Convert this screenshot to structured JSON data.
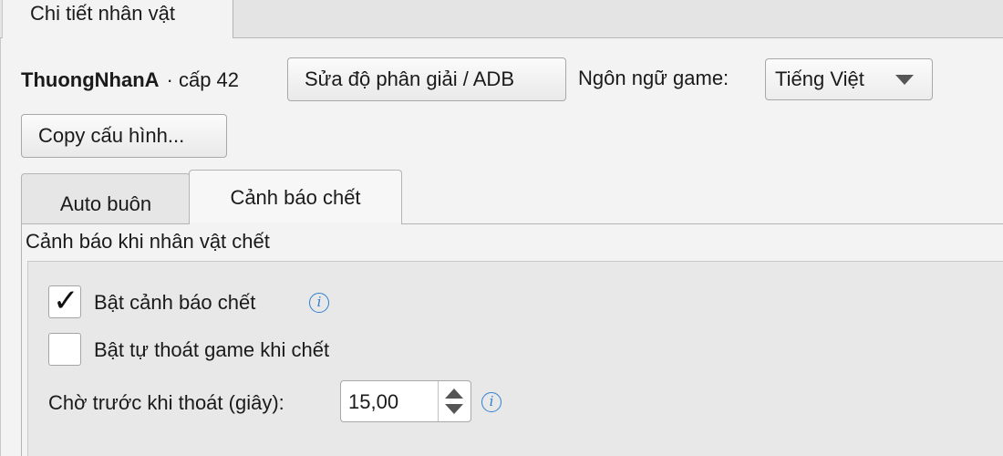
{
  "window": {
    "tab_label": "Chi tiết nhân vật"
  },
  "character": {
    "name": "ThuongNhanA",
    "level_text": "· cấp 42"
  },
  "toolbar": {
    "adb_button_label": "Sửa độ phân giải / ADB",
    "language_label": "Ngôn ngữ game:",
    "language_selected": "Tiếng Việt",
    "copy_config_label": "Copy cấu hình..."
  },
  "tabs": [
    {
      "label": "Auto buôn",
      "active": false
    },
    {
      "label": "Cảnh báo chết",
      "active": true
    }
  ],
  "death_alert": {
    "group_title": "Cảnh báo khi nhân vật chết",
    "enable_alert": {
      "label": "Bật cảnh báo chết",
      "checked": true,
      "checkmark": "✓"
    },
    "auto_exit": {
      "label": "Bật tự thoát game khi chết",
      "checked": false
    },
    "wait_before_exit": {
      "label": "Chờ trước khi thoát (giây):",
      "value": "15,00"
    }
  },
  "icons": {
    "info": "info-icon",
    "info_glyph": "i",
    "dropdown": "chevron-down-icon"
  },
  "colors": {
    "info_blue": "#2f7fd1",
    "background": "#f3f3f3"
  }
}
